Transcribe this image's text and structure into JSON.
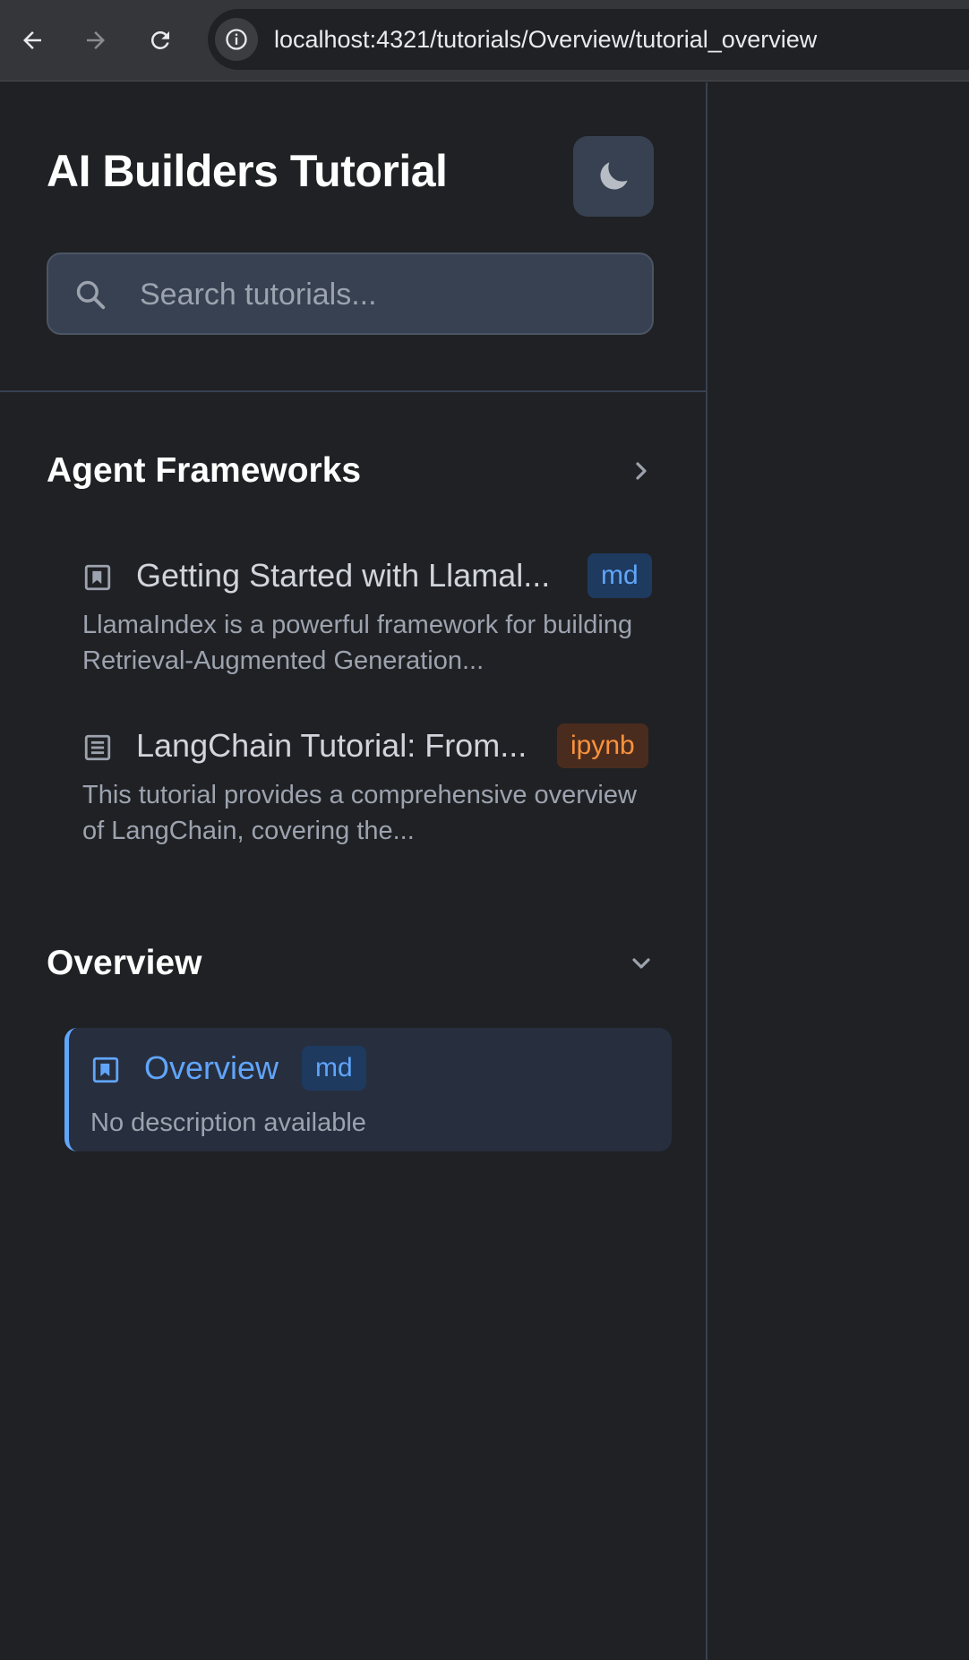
{
  "browser": {
    "url": "localhost:4321/tutorials/Overview/tutorial_overview"
  },
  "sidebar": {
    "title": "AI Builders Tutorial",
    "theme_toggle_icon": "moon-icon",
    "search": {
      "placeholder": "Search tutorials...",
      "value": ""
    },
    "sections": [
      {
        "title": "Agent Frameworks",
        "expanded": false,
        "items": [
          {
            "title": "Getting Started with Llamal...",
            "badge": "md",
            "description": "LlamaIndex is a powerful framework for building Retrieval-Augmented Generation...",
            "icon": "markdown-file-icon"
          },
          {
            "title": "LangChain Tutorial: From...",
            "badge": "ipynb",
            "description": "This tutorial provides a comprehensive overview of LangChain, covering the...",
            "icon": "notebook-file-icon"
          }
        ]
      },
      {
        "title": "Overview",
        "expanded": true,
        "items": [
          {
            "title": "Overview",
            "badge": "md",
            "description": "No description available",
            "icon": "markdown-file-icon",
            "active": true
          }
        ]
      }
    ]
  },
  "colors": {
    "background": "#202124",
    "accent": "#60a5fa",
    "badge_md": "#60a5fa",
    "badge_ipynb": "#fb923c"
  }
}
